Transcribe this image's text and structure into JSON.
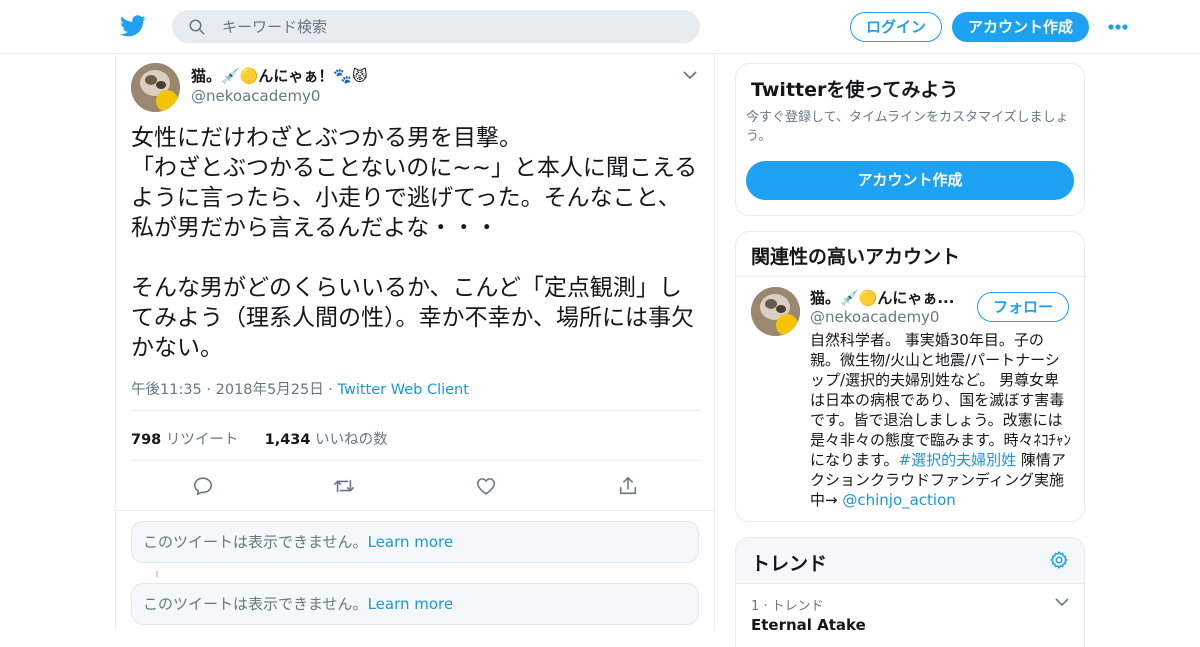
{
  "header": {
    "search_placeholder": "キーワード検索",
    "login_label": "ログイン",
    "signup_label": "アカウント作成"
  },
  "tweet": {
    "display_name": "猫。💉🟡んにゃぁ！🐾😾",
    "handle": "@nekoacademy0",
    "text": "女性にだけわざとぶつかる男を目撃。\n「わざとぶつかることないのに~~」と本人に聞こえるように言ったら、小走りで逃げてった。そんなこと、私が男だから言えるんだよな・・・\n\nそんな男がどのくらいいるか、こんど「定点観測」してみよう（理系人間の性）。幸か不幸か、場所には事欠かない。",
    "timestamp": "午後11:35 · 2018年5月25日",
    "source_separator": " · ",
    "source": "Twitter Web Client",
    "retweets_count": "798",
    "retweets_label": "リツイート",
    "likes_count": "1,434",
    "likes_label": "いいねの数"
  },
  "unavailable": [
    {
      "text": "このツイートは表示できません。",
      "link": "Learn more"
    },
    {
      "text": "このツイートは表示できません。",
      "link": "Learn more"
    }
  ],
  "sidebar": {
    "join": {
      "title": "Twitterを使ってみよう",
      "description": "今すぐ登録して、タイムラインをカスタマイズしましょう。",
      "button": "アカウント作成"
    },
    "related": {
      "title": "関連性の高いアカウント",
      "name": "猫。💉🟡んにゃぁ...",
      "handle": "@nekoacademy0",
      "follow_label": "フォロー",
      "bio_text": "自然科学者。 事実婚30年目。子の親。微生物/火山と地震/パートナーシップ/選択的夫婦別姓など。 男尊女卑は日本の病根であり、国を滅ぼす害毒です。皆で退治しましょう。改憲には是々非々の態度で臨みます。時々ﾈｺﾁｬﾝになります。",
      "bio_hashtag": "#選択的夫婦別姓",
      "bio_after": " 陳情アクションクラウドファンディング実施中→ ",
      "bio_mention": "@chinjo_action"
    },
    "trends": {
      "title": "トレンド",
      "items": [
        {
          "rank": "1 · トレンド",
          "name": "Eternal Atake"
        }
      ]
    }
  },
  "colors": {
    "brand_blue": "#1da1f2",
    "link_blue": "#1b95e0",
    "secondary_text": "#657786",
    "border": "#e6ecf0"
  },
  "icons": [
    "twitter-bird-icon",
    "search-icon",
    "more-dots-icon",
    "chevron-down-icon",
    "reply-icon",
    "retweet-icon",
    "like-icon",
    "share-icon",
    "gear-icon"
  ]
}
